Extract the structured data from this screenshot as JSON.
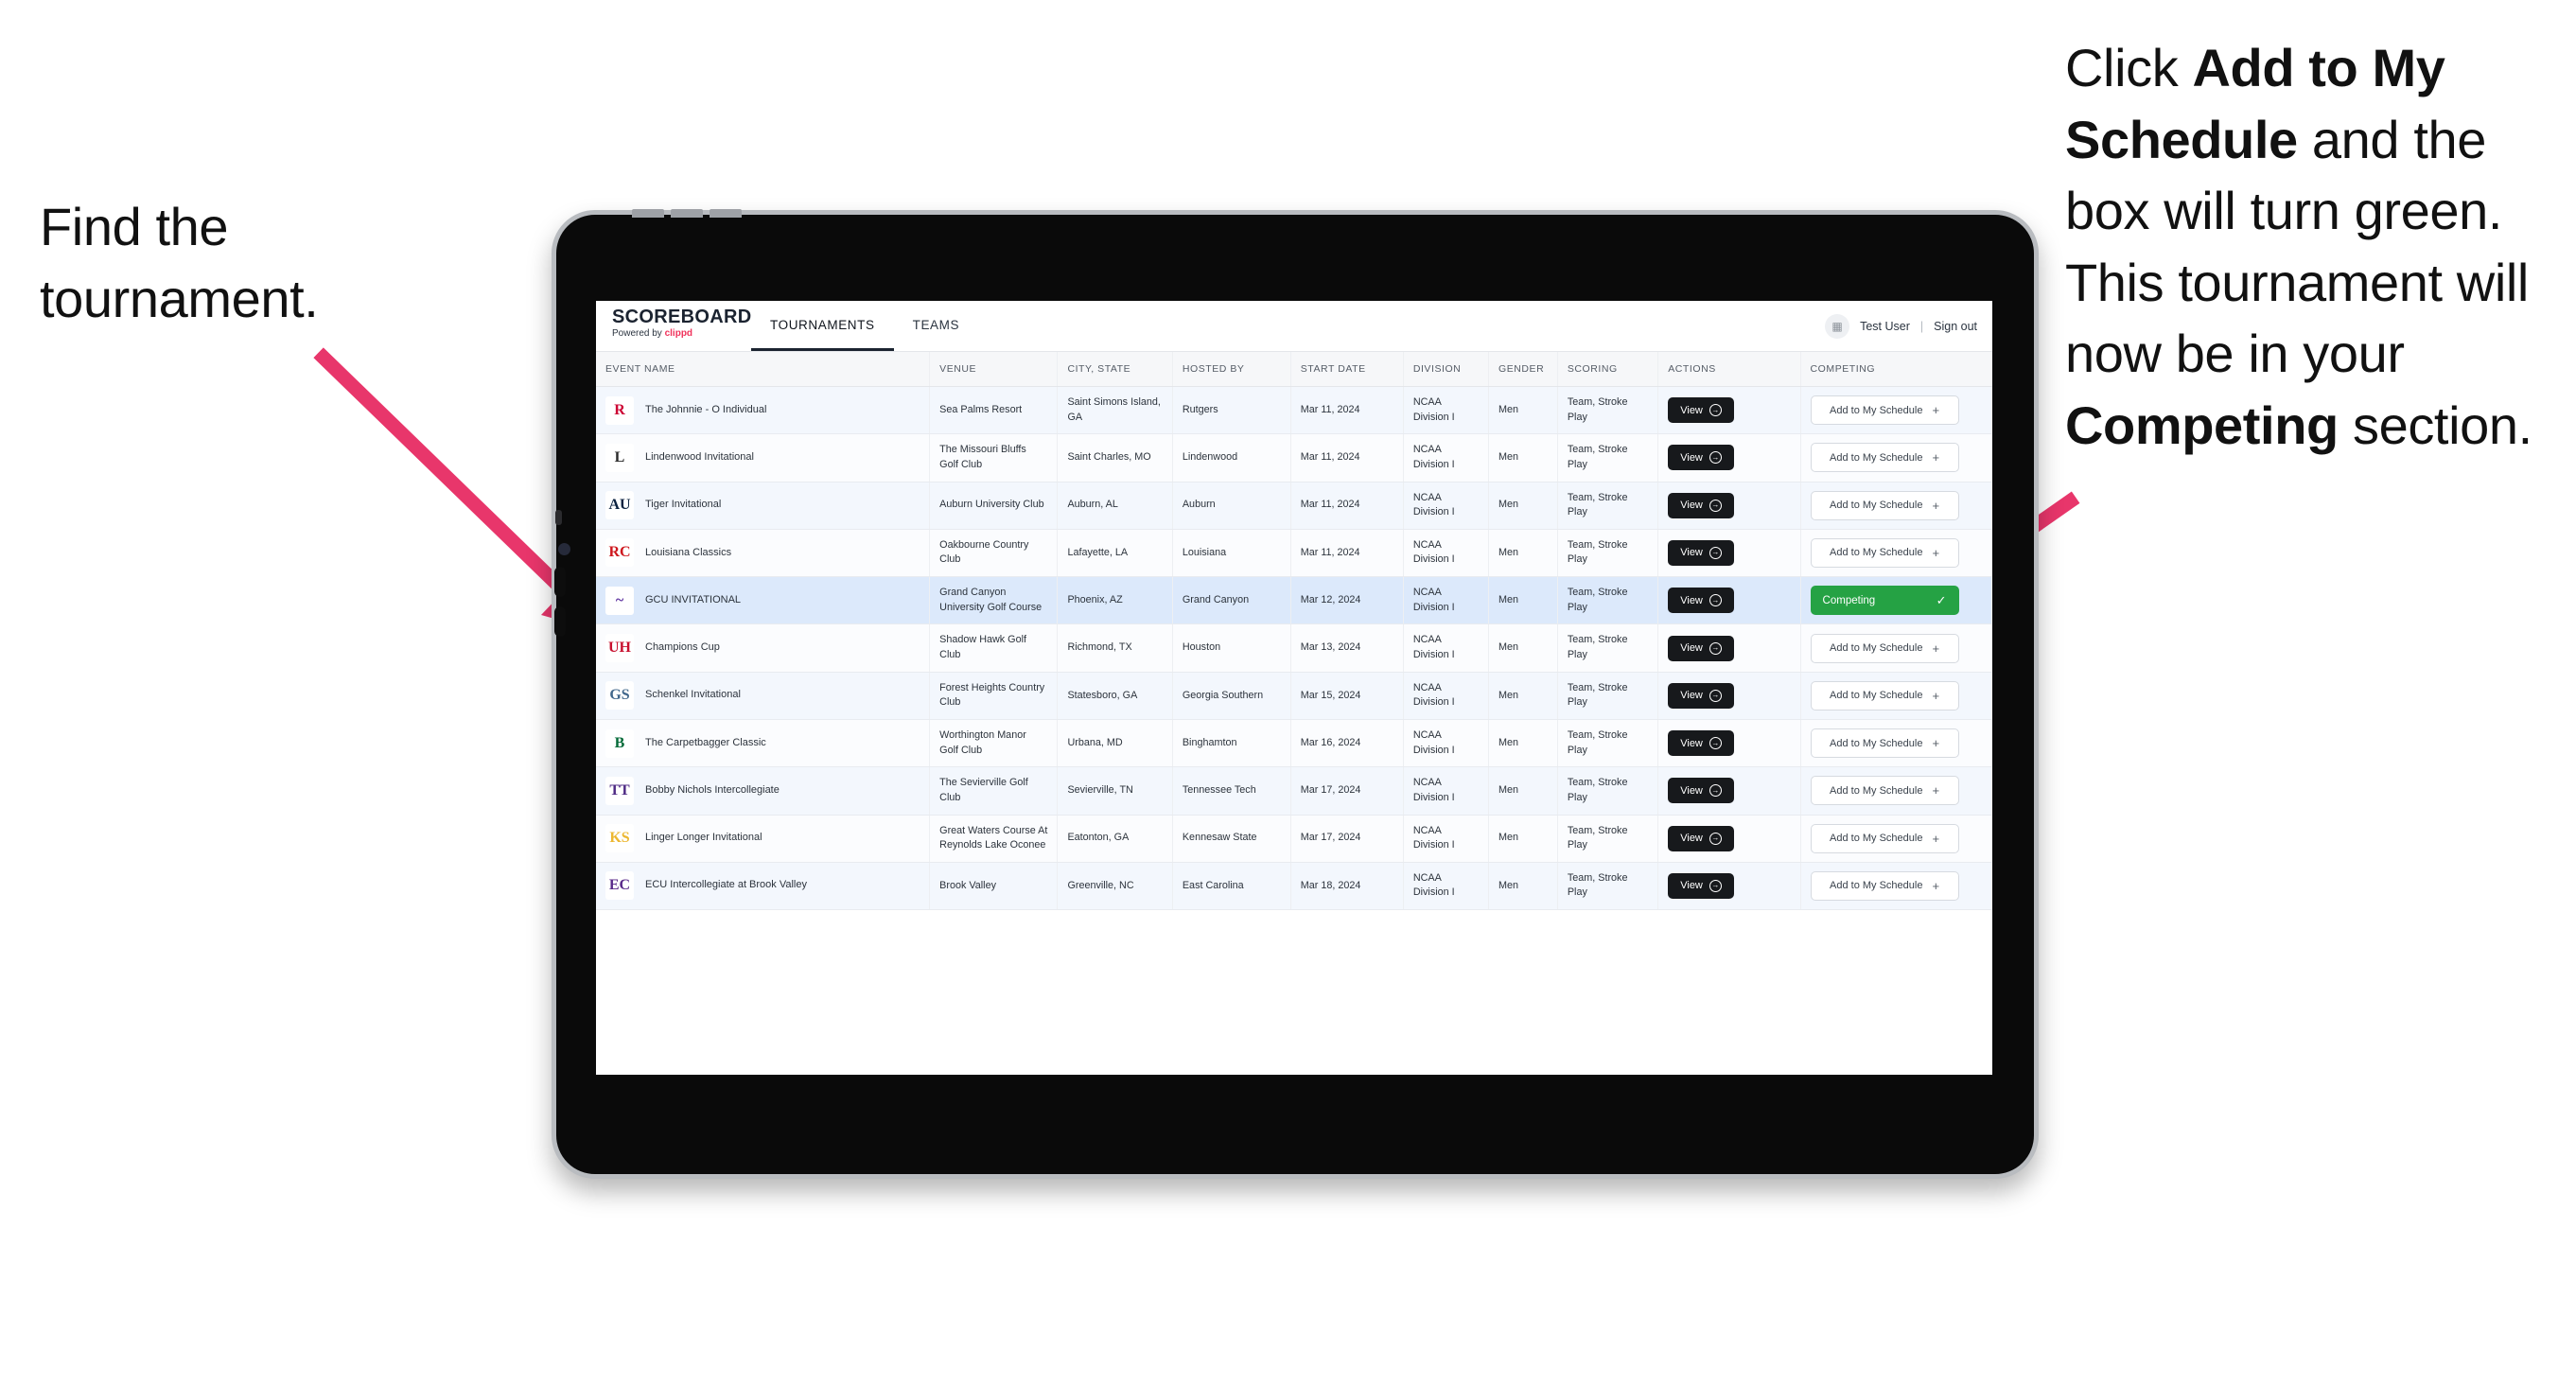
{
  "annotations": {
    "left": "Find the tournament.",
    "right_parts": [
      {
        "text": "Click ",
        "bold": false
      },
      {
        "text": "Add to My Schedule",
        "bold": true
      },
      {
        "text": " and the box will turn green. This tournament will now be in your ",
        "bold": false
      },
      {
        "text": "Competing",
        "bold": true
      },
      {
        "text": " section.",
        "bold": false
      }
    ],
    "arrow_color": "#e8366b"
  },
  "app": {
    "brand": {
      "title": "SCOREBOARD",
      "powered_prefix": "Powered by ",
      "powered_brand": "clippd",
      "brand_color": "#f0325b"
    },
    "tabs": [
      {
        "label": "TOURNAMENTS",
        "active": true
      },
      {
        "label": "TEAMS",
        "active": false
      }
    ],
    "account": {
      "avatar_icon": "grid-icon",
      "user": "Test User",
      "separator": "|",
      "sign_out": "Sign out"
    }
  },
  "table": {
    "columns": [
      "EVENT NAME",
      "VENUE",
      "CITY, STATE",
      "HOSTED BY",
      "START DATE",
      "DIVISION",
      "GENDER",
      "SCORING",
      "ACTIONS",
      "COMPETING"
    ],
    "action_label": "View",
    "add_label": "Add to My Schedule",
    "add_plus": "+",
    "competing_label": "Competing",
    "competing_check": "✓",
    "competing_color": "#25a244",
    "rows": [
      {
        "logo_text": "R",
        "logo_fg": "#cc0033",
        "logo_bg": "#ffffff",
        "event": "The Johnnie - O Individual",
        "venue": "Sea Palms Resort",
        "city": "Saint Simons Island, GA",
        "host": "Rutgers",
        "date": "Mar 11, 2024",
        "division": "NCAA Division I",
        "gender": "Men",
        "scoring": "Team, Stroke Play",
        "competing": false
      },
      {
        "logo_text": "L",
        "logo_fg": "#2b2b2b",
        "logo_bg": "#ffffff",
        "event": "Lindenwood Invitational",
        "venue": "The Missouri Bluffs Golf Club",
        "city": "Saint Charles, MO",
        "host": "Lindenwood",
        "date": "Mar 11, 2024",
        "division": "NCAA Division I",
        "gender": "Men",
        "scoring": "Team, Stroke Play",
        "competing": false
      },
      {
        "logo_text": "AU",
        "logo_fg": "#0c2340",
        "logo_bg": "#ffffff",
        "event": "Tiger Invitational",
        "venue": "Auburn University Club",
        "city": "Auburn, AL",
        "host": "Auburn",
        "date": "Mar 11, 2024",
        "division": "NCAA Division I",
        "gender": "Men",
        "scoring": "Team, Stroke Play",
        "competing": false
      },
      {
        "logo_text": "RC",
        "logo_fg": "#ce181e",
        "logo_bg": "#ffffff",
        "event": "Louisiana Classics",
        "venue": "Oakbourne Country Club",
        "city": "Lafayette, LA",
        "host": "Louisiana",
        "date": "Mar 11, 2024",
        "division": "NCAA Division I",
        "gender": "Men",
        "scoring": "Team, Stroke Play",
        "competing": false
      },
      {
        "logo_text": "~",
        "logo_fg": "#522398",
        "logo_bg": "#ffffff",
        "event": "GCU INVITATIONAL",
        "venue": "Grand Canyon University Golf Course",
        "city": "Phoenix, AZ",
        "host": "Grand Canyon",
        "date": "Mar 12, 2024",
        "division": "NCAA Division I",
        "gender": "Men",
        "scoring": "Team, Stroke Play",
        "competing": true,
        "selected": true
      },
      {
        "logo_text": "UH",
        "logo_fg": "#c8102e",
        "logo_bg": "#ffffff",
        "event": "Champions Cup",
        "venue": "Shadow Hawk Golf Club",
        "city": "Richmond, TX",
        "host": "Houston",
        "date": "Mar 13, 2024",
        "division": "NCAA Division I",
        "gender": "Men",
        "scoring": "Team, Stroke Play",
        "competing": false
      },
      {
        "logo_text": "GS",
        "logo_fg": "#41678b",
        "logo_bg": "#ffffff",
        "event": "Schenkel Invitational",
        "venue": "Forest Heights Country Club",
        "city": "Statesboro, GA",
        "host": "Georgia Southern",
        "date": "Mar 15, 2024",
        "division": "NCAA Division I",
        "gender": "Men",
        "scoring": "Team, Stroke Play",
        "competing": false
      },
      {
        "logo_text": "B",
        "logo_fg": "#046a38",
        "logo_bg": "#ffffff",
        "event": "The Carpetbagger Classic",
        "venue": "Worthington Manor Golf Club",
        "city": "Urbana, MD",
        "host": "Binghamton",
        "date": "Mar 16, 2024",
        "division": "NCAA Division I",
        "gender": "Men",
        "scoring": "Team, Stroke Play",
        "competing": false
      },
      {
        "logo_text": "TT",
        "logo_fg": "#4e2a84",
        "logo_bg": "#ffffff",
        "event": "Bobby Nichols Intercollegiate",
        "venue": "The Sevierville Golf Club",
        "city": "Sevierville, TN",
        "host": "Tennessee Tech",
        "date": "Mar 17, 2024",
        "division": "NCAA Division I",
        "gender": "Men",
        "scoring": "Team, Stroke Play",
        "competing": false
      },
      {
        "logo_text": "KS",
        "logo_fg": "#ecb731",
        "logo_bg": "#ffffff",
        "event": "Linger Longer Invitational",
        "venue": "Great Waters Course At Reynolds Lake Oconee",
        "city": "Eatonton, GA",
        "host": "Kennesaw State",
        "date": "Mar 17, 2024",
        "division": "NCAA Division I",
        "gender": "Men",
        "scoring": "Team, Stroke Play",
        "competing": false
      },
      {
        "logo_text": "EC",
        "logo_fg": "#592a8a",
        "logo_bg": "#ffffff",
        "event": "ECU Intercollegiate at Brook Valley",
        "venue": "Brook Valley",
        "city": "Greenville, NC",
        "host": "East Carolina",
        "date": "Mar 18, 2024",
        "division": "NCAA Division I",
        "gender": "Men",
        "scoring": "Team, Stroke Play",
        "competing": false,
        "clipped": true
      }
    ]
  }
}
